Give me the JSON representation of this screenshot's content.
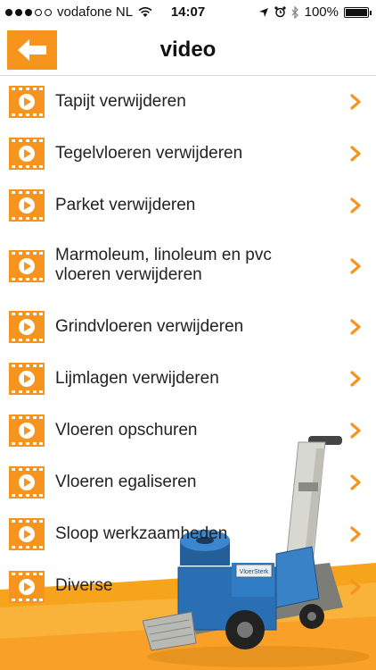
{
  "status_bar": {
    "carrier": "vodafone NL",
    "time": "14:07",
    "battery": "100%",
    "battery_level": 1.0,
    "signal_bars_filled": 3,
    "signal_bars_total": 5
  },
  "navbar": {
    "title": "video",
    "back_icon": "arrow-left-icon"
  },
  "colors": {
    "accent": "#f7941d",
    "text": "#222222"
  },
  "items": [
    {
      "label": "Tapijt verwijderen"
    },
    {
      "label": "Tegelvloeren verwijderen"
    },
    {
      "label": "Parket verwijderen"
    },
    {
      "label": "Marmoleum, linoleum en pvc vloeren verwijderen"
    },
    {
      "label": "Grindvloeren verwijderen"
    },
    {
      "label": "Lijmlagen verwijderen"
    },
    {
      "label": "Vloeren opschuren"
    },
    {
      "label": "Vloeren egaliseren"
    },
    {
      "label": "Sloop werkzaamheden"
    },
    {
      "label": "Diverse"
    }
  ],
  "machine_brand": "VloerSterk"
}
